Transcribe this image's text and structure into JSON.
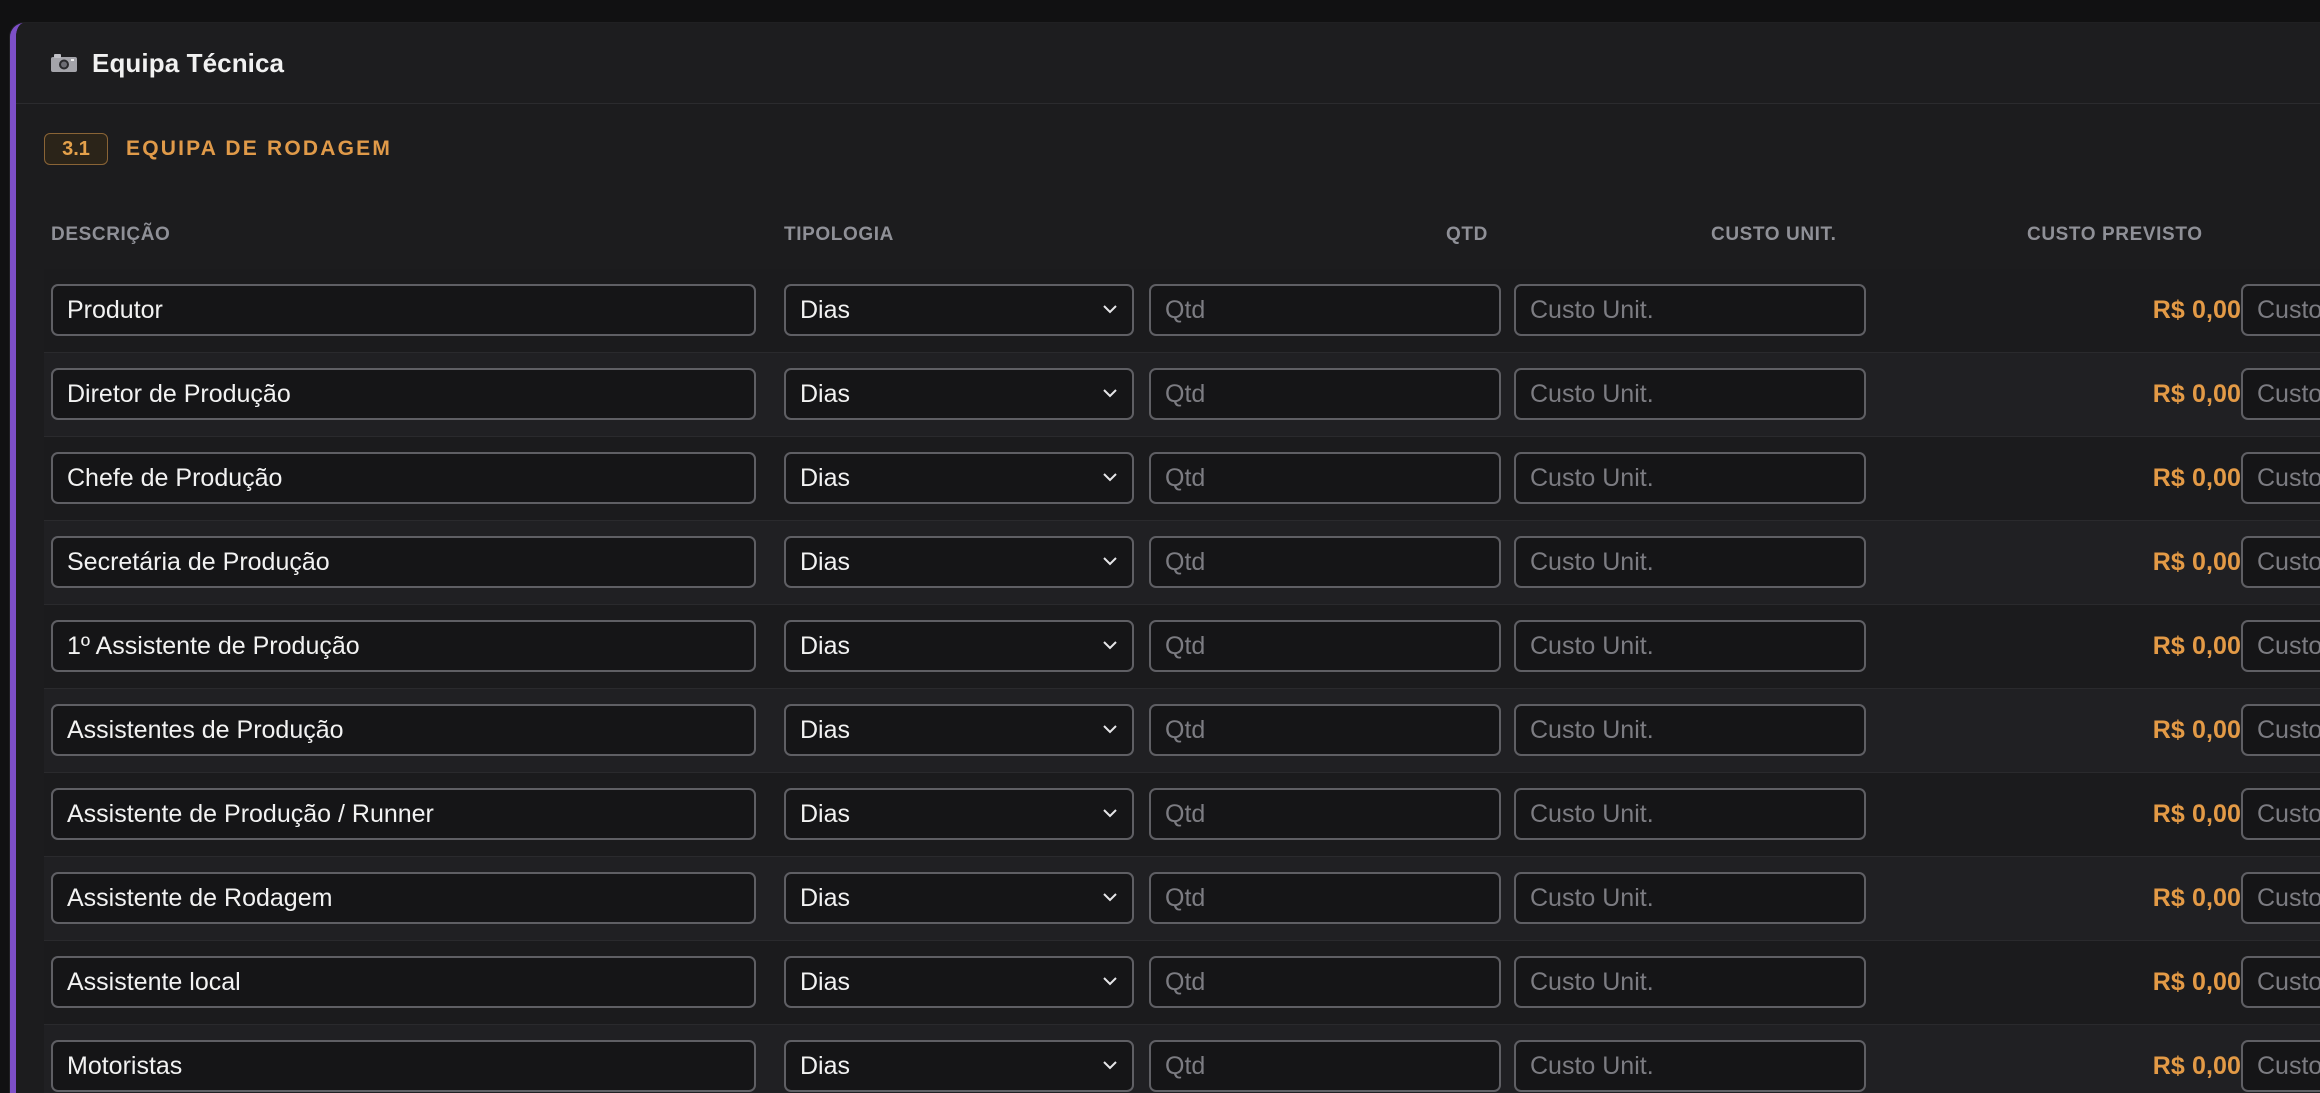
{
  "panel": {
    "title": "Equipa Técnica",
    "icon": "camera-icon"
  },
  "section": {
    "number": "3.1",
    "title": "EQUIPA DE RODAGEM"
  },
  "table": {
    "headers": {
      "descricao": "DESCRIÇÃO",
      "tipologia": "TIPOLOGIA",
      "qtd": "QTD",
      "custo_unit": "CUSTO UNIT.",
      "custo_previsto": "CUSTO PREVISTO"
    },
    "placeholders": {
      "qtd": "Qtd",
      "custo_unit": "Custo Unit.",
      "custo_real": "Custo R"
    },
    "rows": [
      {
        "descricao": "Produtor",
        "tipologia": "Dias",
        "custo_previsto": "R$ 0,00"
      },
      {
        "descricao": "Diretor de Produção",
        "tipologia": "Dias",
        "custo_previsto": "R$ 0,00"
      },
      {
        "descricao": "Chefe de Produção",
        "tipologia": "Dias",
        "custo_previsto": "R$ 0,00"
      },
      {
        "descricao": "Secretária de Produção",
        "tipologia": "Dias",
        "custo_previsto": "R$ 0,00"
      },
      {
        "descricao": "1º Assistente de Produção",
        "tipologia": "Dias",
        "custo_previsto": "R$ 0,00"
      },
      {
        "descricao": "Assistentes de Produção",
        "tipologia": "Dias",
        "custo_previsto": "R$ 0,00"
      },
      {
        "descricao": "Assistente de Produção / Runner",
        "tipologia": "Dias",
        "custo_previsto": "R$ 0,00"
      },
      {
        "descricao": "Assistente de Rodagem",
        "tipologia": "Dias",
        "custo_previsto": "R$ 0,00"
      },
      {
        "descricao": "Assistente local",
        "tipologia": "Dias",
        "custo_previsto": "R$ 0,00"
      },
      {
        "descricao": "Motoristas",
        "tipologia": "Dias",
        "custo_previsto": "R$ 0,00"
      }
    ]
  },
  "colors": {
    "accent_purple": "#7d4fc7",
    "amount_orange": "#e39a46",
    "section_orange": "#e09a49"
  }
}
